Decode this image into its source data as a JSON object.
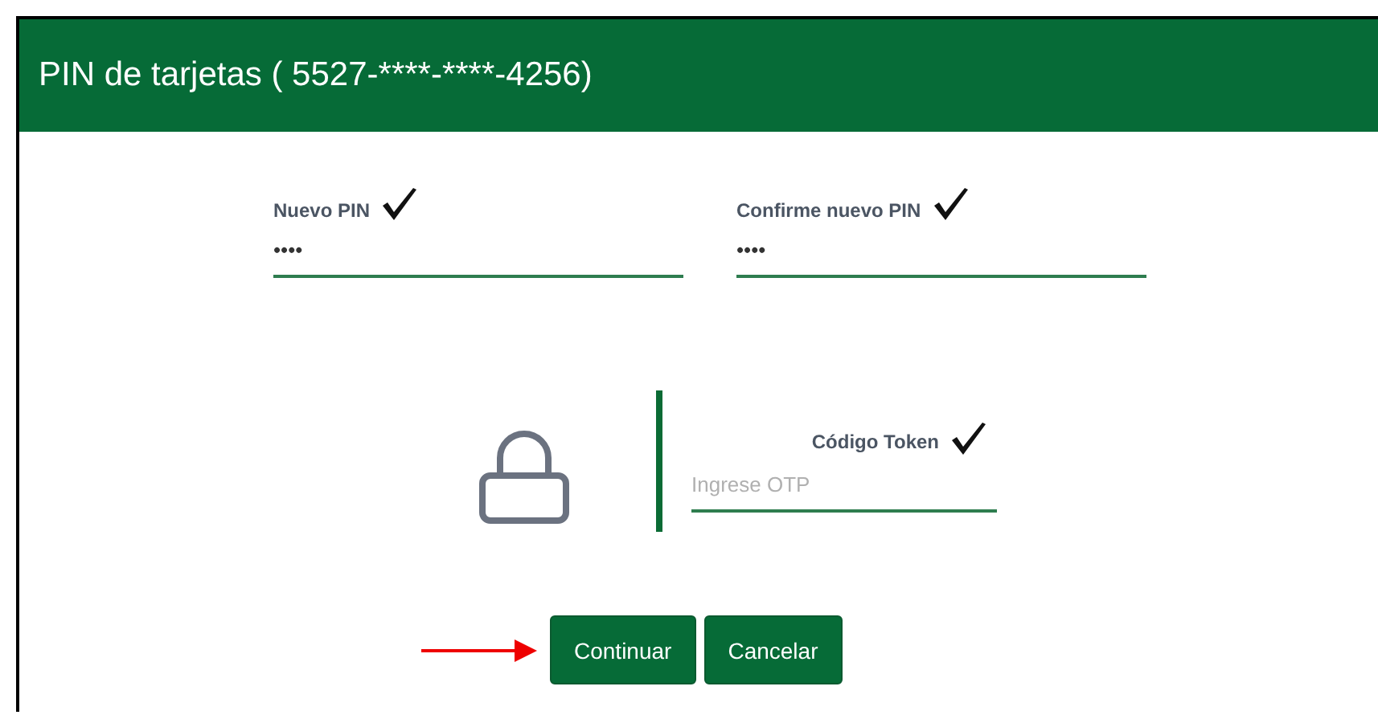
{
  "dialog": {
    "title": "PIN de tarjetas ( 5527-****-****-4256)"
  },
  "pin_fields": [
    {
      "label": "Nuevo PIN",
      "value": "••••",
      "valid": true
    },
    {
      "label": "Confirme nuevo PIN",
      "value": "••••",
      "valid": true
    }
  ],
  "token_field": {
    "label": "Código Token",
    "placeholder": "Ingrese OTP",
    "valid": true
  },
  "buttons": [
    {
      "label": "Continuar",
      "highlighted": true
    },
    {
      "label": "Cancelar",
      "highlighted": false
    }
  ]
}
